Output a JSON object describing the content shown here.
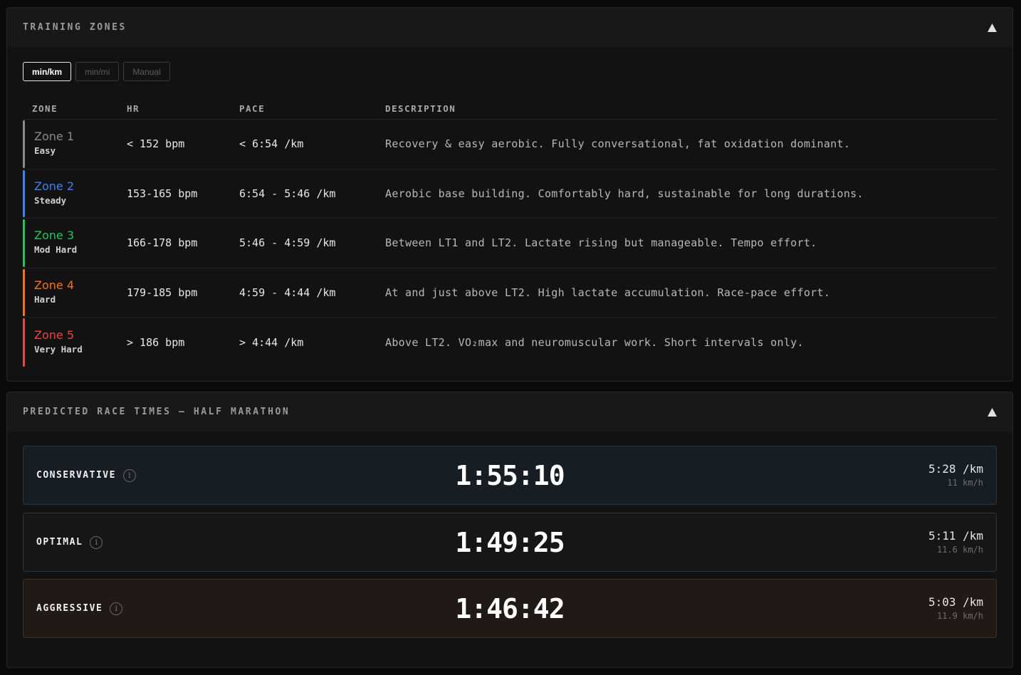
{
  "zones_panel": {
    "title": "TRAINING ZONES",
    "collapse_icon": "triangle-up-icon",
    "unit_toggles": [
      {
        "label": "min/km",
        "active": true
      },
      {
        "label": "min/mi",
        "active": false
      },
      {
        "label": "Manual",
        "active": false
      }
    ],
    "columns": [
      "ZONE",
      "HR",
      "PACE",
      "DESCRIPTION"
    ],
    "rows": [
      {
        "name": "Zone 1",
        "sub": "Easy",
        "hr": "< 152 bpm",
        "pace": "< 6:54 /km",
        "desc": "Recovery & easy aerobic. Fully conversational, fat oxidation dominant.",
        "color": "#8a8a8a"
      },
      {
        "name": "Zone 2",
        "sub": "Steady",
        "hr": "153-165 bpm",
        "pace": "6:54 - 5:46 /km",
        "desc": "Aerobic base building. Comfortably hard, sustainable for long durations.",
        "color": "#3b82f6"
      },
      {
        "name": "Zone 3",
        "sub": "Mod Hard",
        "hr": "166-178 bpm",
        "pace": "5:46 - 4:59 /km",
        "desc": "Between LT1 and LT2. Lactate rising but manageable. Tempo effort.",
        "color": "#22c55e"
      },
      {
        "name": "Zone 4",
        "sub": "Hard",
        "hr": "179-185 bpm",
        "pace": "4:59 - 4:44 /km",
        "desc": "At and just above LT2. High lactate accumulation. Race-pace effort.",
        "color": "#f97316"
      },
      {
        "name": "Zone 5",
        "sub": "Very Hard",
        "hr": "> 186 bpm",
        "pace": "> 4:44 /km",
        "desc": "Above LT2. VO₂max and neuromuscular work. Short intervals only.",
        "color": "#ef4444"
      }
    ]
  },
  "race_panel": {
    "title": "PREDICTED RACE TIMES — HALF MARATHON",
    "collapse_icon": "triangle-up-icon",
    "predictions": [
      {
        "label": "CONSERVATIVE",
        "time": "1:55:10",
        "pace": "5:28 /km",
        "speed": "11 km/h",
        "info_icon": "info-icon"
      },
      {
        "label": "OPTIMAL",
        "time": "1:49:25",
        "pace": "5:11 /km",
        "speed": "11.6 km/h",
        "info_icon": "info-icon"
      },
      {
        "label": "AGGRESSIVE",
        "time": "1:46:42",
        "pace": "5:03 /km",
        "speed": "11.9 km/h",
        "info_icon": "info-icon"
      }
    ]
  }
}
